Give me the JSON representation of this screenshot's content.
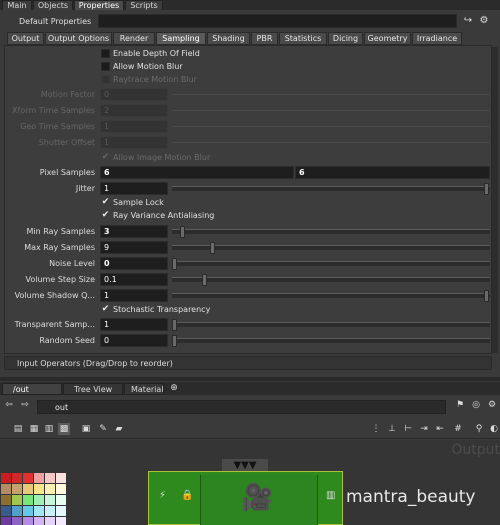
{
  "top_tabs": [
    "Main",
    "Objects",
    "Properties",
    "Scripts"
  ],
  "header": {
    "label": "Default Properties"
  },
  "sub_tabs": [
    "Output",
    "Output Options",
    "Render",
    "Sampling",
    "Shading",
    "PBR",
    "Statistics",
    "Dicing",
    "Geometry",
    "Irradiance"
  ],
  "active_sub_tab": "Sampling",
  "checkboxes": {
    "depth_of_field": "Enable Depth Of Field",
    "motion_blur": "Allow Motion Blur",
    "raytrace_motion_blur": "Raytrace Motion Blur",
    "image_motion_blur": "Allow Image Motion Blur",
    "sample_lock": "Sample Lock",
    "ray_variance": "Ray Variance Antialiasing",
    "stochastic": "Stochastic Transparency"
  },
  "params": {
    "motion_factor": {
      "label": "Motion Factor",
      "value": "0"
    },
    "xform_samples": {
      "label": "Xform Time Samples",
      "value": "2"
    },
    "geo_samples": {
      "label": "Geo Time Samples",
      "value": "1"
    },
    "shutter_offset": {
      "label": "Shutter Offset",
      "value": "1"
    },
    "pixel_samples": {
      "label": "Pixel Samples",
      "value_x": "6",
      "value_y": "6"
    },
    "jitter": {
      "label": "Jitter",
      "value": "1"
    },
    "min_ray": {
      "label": "Min Ray Samples",
      "value": "3"
    },
    "max_ray": {
      "label": "Max Ray Samples",
      "value": "9"
    },
    "noise_level": {
      "label": "Noise Level",
      "value": "0"
    },
    "volume_step": {
      "label": "Volume Step Size",
      "value": "0.1"
    },
    "volume_shadow": {
      "label": "Volume Shadow Q...",
      "value": "1"
    },
    "transparent": {
      "label": "Transparent Samp...",
      "value": "1"
    },
    "random_seed": {
      "label": "Random Seed",
      "value": "0"
    }
  },
  "input_operators": "Input Operators (Drag/Drop to reorder)",
  "pane_tabs": [
    "/out",
    "Tree View",
    "Material Palette"
  ],
  "path": "out",
  "network_watermark": "Output",
  "node": {
    "name": "mantra_beauty"
  },
  "colors": {
    "node_fill": "#2f8a1e",
    "node_border": "#a8c23a",
    "background": "#3a3a3a"
  }
}
